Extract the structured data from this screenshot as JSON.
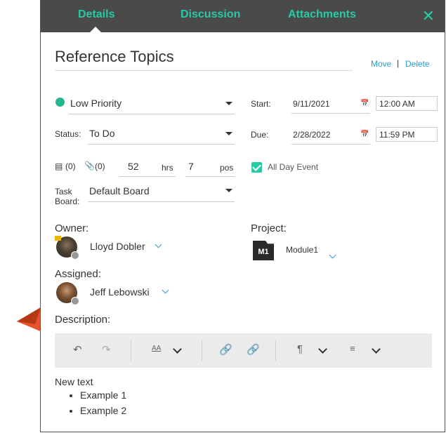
{
  "tabs": {
    "details": "Details",
    "discussion": "Discussion",
    "attachments": "Attachments"
  },
  "close_glyph": "✕",
  "title": "Reference Topics",
  "actions": {
    "move": "Move",
    "separator": "|",
    "delete": "Delete"
  },
  "priority": {
    "value": "Low Priority",
    "color": "#27b590"
  },
  "status": {
    "label": "Status:",
    "value": "To Do"
  },
  "start": {
    "label": "Start:",
    "date": "9/11/2021",
    "time": "12:00 AM"
  },
  "due": {
    "label": "Due:",
    "date": "2/28/2022",
    "time": "11:59 PM"
  },
  "counts": {
    "notes": "(0)",
    "attachments": "(0)"
  },
  "hours": {
    "value": "52",
    "unit": "hrs"
  },
  "position": {
    "value": "7",
    "unit": "pos"
  },
  "all_day": {
    "label": "All Day Event",
    "checked": true
  },
  "task_board": {
    "label_line1": "Task",
    "label_line2": "Board:",
    "value": "Default Board"
  },
  "owner": {
    "label": "Owner:",
    "name": "Lloyd Dobler"
  },
  "project": {
    "label": "Project:",
    "badge": "M1",
    "name": "Module1"
  },
  "assigned": {
    "label": "Assigned:",
    "name": "Jeff Lebowski"
  },
  "description": {
    "label": "Description:",
    "text": "New text",
    "items": [
      "Example 1",
      "Example 2"
    ]
  },
  "colors": {
    "accent": "#27c9a8",
    "header_bg": "#4a4a4a",
    "link": "#2a9fd6",
    "pointer": "#e8532a"
  }
}
